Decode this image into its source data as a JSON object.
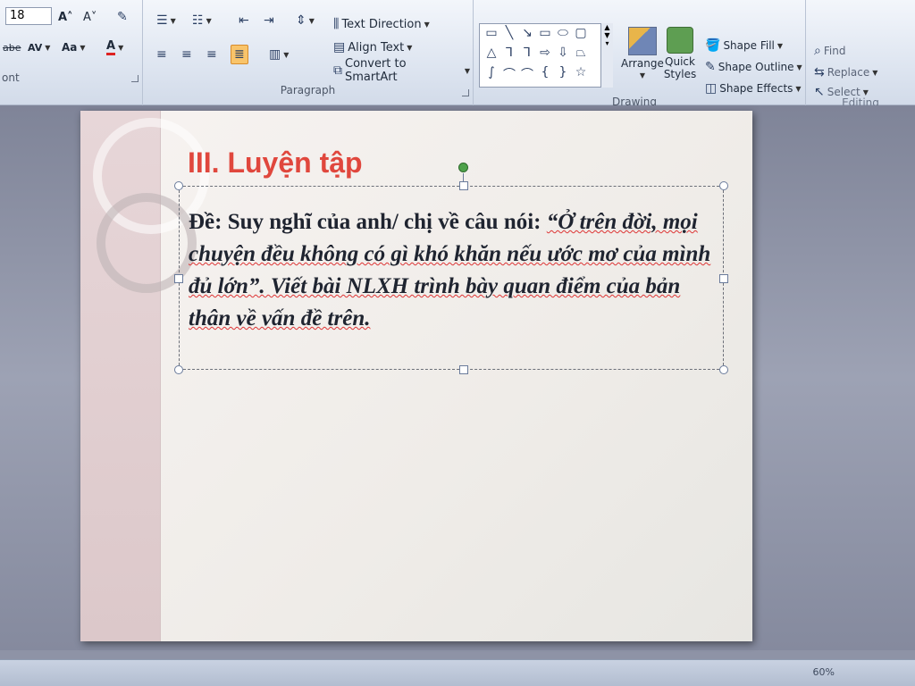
{
  "ribbon": {
    "font_group": {
      "label": "ont",
      "font_size": "18",
      "grow_font": "A˄",
      "shrink_font": "A˅",
      "char_spacing": "AV",
      "change_case": "Aa",
      "font_color_letter": "A",
      "strike_label": "abe"
    },
    "paragraph_group": {
      "label": "Paragraph",
      "text_direction": "Text Direction",
      "align_text": "Align Text",
      "convert_smartart": "Convert to SmartArt"
    },
    "drawing_group": {
      "label": "Drawing",
      "arrange": "Arrange",
      "quick_styles": "Quick Styles",
      "shape_fill": "Shape Fill",
      "shape_outline": "Shape Outline",
      "shape_effects": "Shape Effects"
    },
    "editing_group": {
      "label": "Editing",
      "find": "Find",
      "replace": "Replace",
      "select": "Select"
    }
  },
  "slide": {
    "title": "III. Luyện tập",
    "body_lead": "Đề: Suy nghĩ của anh/ chị về câu nói: ",
    "body_italic": "“Ở trên đời, mọi chuyện đều không có gì khó khăn nếu ước mơ của mình đủ lớn”. Viết bài NLXH trình bày quan điểm của bản thân về vấn đề trên."
  },
  "status": {
    "zoom": "60%"
  },
  "colors": {
    "title": "#e0473d",
    "accent": "#f9c46a"
  }
}
